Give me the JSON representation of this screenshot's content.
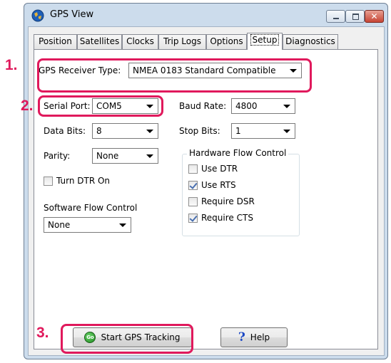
{
  "window": {
    "title": "GPS View"
  },
  "tabs": [
    {
      "label": "Position"
    },
    {
      "label": "Satellites"
    },
    {
      "label": "Clocks"
    },
    {
      "label": "Trip Logs"
    },
    {
      "label": "Options"
    },
    {
      "label": "Setup",
      "active": true
    },
    {
      "label": "Diagnostics"
    }
  ],
  "setup": {
    "receiver_type_label": "GPS Receiver Type:",
    "receiver_type_value": "NMEA 0183 Standard Compatible",
    "serial_port_label": "Serial Port:",
    "serial_port_value": "COM5",
    "baud_rate_label": "Baud Rate:",
    "baud_rate_value": "4800",
    "data_bits_label": "Data Bits:",
    "data_bits_value": "8",
    "stop_bits_label": "Stop Bits:",
    "stop_bits_value": "1",
    "parity_label": "Parity:",
    "parity_value": "None",
    "turn_dtr_label": "Turn DTR On",
    "turn_dtr_checked": false,
    "software_flow_label": "Software Flow Control",
    "software_flow_value": "None",
    "hardware_flow": {
      "title": "Hardware Flow Control",
      "items": [
        {
          "label": "Use DTR",
          "checked": false
        },
        {
          "label": "Use RTS",
          "checked": true
        },
        {
          "label": "Require DSR",
          "checked": false
        },
        {
          "label": "Require CTS",
          "checked": true
        }
      ]
    },
    "start_button_label": "Start GPS Tracking",
    "start_icon_text": "Go",
    "help_button_label": "Help"
  },
  "annotations": [
    "1.",
    "2.",
    "3."
  ],
  "colors": {
    "highlight": "#e0195c",
    "window_frame": "#ccdcec",
    "checkmark": "#4a70b0"
  },
  "icons": {
    "app": "globe-icon",
    "start": "go-icon",
    "help": "question-mark-icon"
  }
}
